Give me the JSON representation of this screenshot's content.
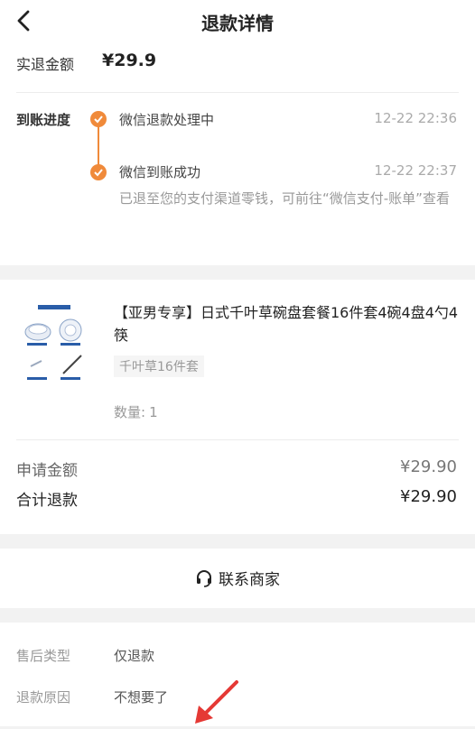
{
  "header": {
    "title": "退款详情"
  },
  "refund": {
    "amount_label": "实退金额",
    "amount_value": "¥29.9"
  },
  "progress": {
    "label": "到账进度",
    "steps": [
      {
        "text": "微信退款处理中",
        "time": "12-22 22:36"
      },
      {
        "text": "微信到账成功",
        "time": "12-22 22:37"
      }
    ],
    "note": "已退至您的支付渠道零钱，可前往“微信支付-账单”查看"
  },
  "product": {
    "name": "【亚男专享】日式千叶草碗盘套餐16件套4碗4盘4勺4筷",
    "spec": "千叶草16件套",
    "qty_label": "数量:",
    "qty_value": "1"
  },
  "amounts": {
    "apply_label": "申请金额",
    "apply_value": "¥29.90",
    "total_label": "合计退款",
    "total_value": "¥29.90"
  },
  "contact": {
    "label": "联系商家",
    "icon": "headset-icon"
  },
  "info": {
    "type_label": "售后类型",
    "type_value": "仅退款",
    "reason_label": "退款原因",
    "reason_value": "不想要了"
  },
  "colors": {
    "accent": "#f08a3a",
    "annotation": "#e53935"
  }
}
